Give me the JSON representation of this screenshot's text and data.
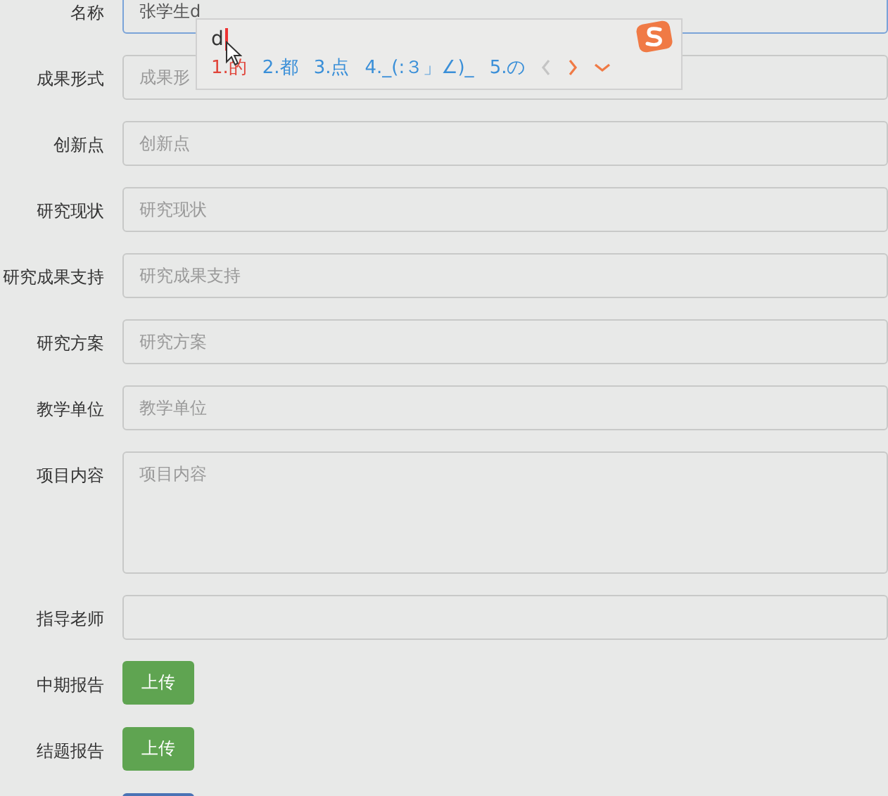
{
  "form": {
    "fields": [
      {
        "label": "名称",
        "kind": "input",
        "value": "张学生d",
        "focused": true
      },
      {
        "label": "成果形式",
        "kind": "input",
        "placeholder": "成果形",
        "focused": false
      },
      {
        "label": "创新点",
        "kind": "input",
        "placeholder": "创新点",
        "focused": false
      },
      {
        "label": "研究现状",
        "kind": "input",
        "placeholder": "研究现状",
        "focused": false
      },
      {
        "label": "研究成果支持",
        "kind": "input",
        "placeholder": "研究成果支持",
        "focused": false
      },
      {
        "label": "研究方案",
        "kind": "input",
        "placeholder": "研究方案",
        "focused": false
      },
      {
        "label": "教学单位",
        "kind": "input",
        "placeholder": "教学单位",
        "focused": false
      },
      {
        "label": "项目内容",
        "kind": "textarea",
        "placeholder": "项目内容",
        "focused": false
      },
      {
        "label": "指导老师",
        "kind": "input",
        "focused": false
      },
      {
        "label": "中期报告",
        "kind": "upload",
        "button": "上传"
      },
      {
        "label": "结题报告",
        "kind": "upload",
        "button": "上传"
      },
      {
        "kind": "submit"
      }
    ]
  },
  "ime": {
    "composition": "d",
    "candidates": [
      {
        "label": "1.的",
        "selected": true
      },
      {
        "label": "2.都",
        "selected": false
      },
      {
        "label": "3.点",
        "selected": false
      },
      {
        "label": "4._(:３」∠)_",
        "selected": false
      },
      {
        "label": "5.の",
        "selected": false
      }
    ],
    "prev_disabled": true,
    "next_disabled": false
  }
}
